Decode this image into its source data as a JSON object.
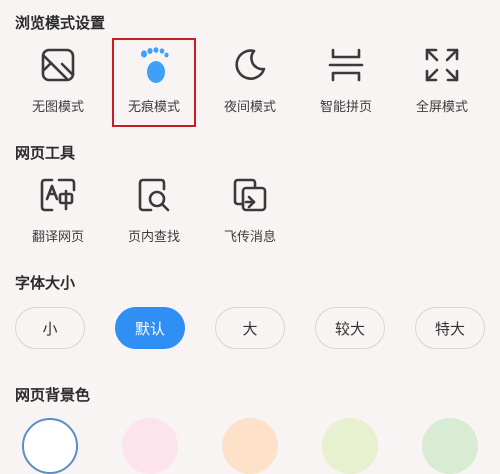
{
  "browse_mode": {
    "title": "浏览模式设置",
    "items": [
      {
        "label": "无图模式",
        "icon": "no-image-icon"
      },
      {
        "label": "无痕模式",
        "icon": "footprint-icon",
        "highlighted": true
      },
      {
        "label": "夜间模式",
        "icon": "moon-icon"
      },
      {
        "label": "智能拼页",
        "icon": "smart-page-icon"
      },
      {
        "label": "全屏模式",
        "icon": "fullscreen-icon"
      }
    ]
  },
  "web_tools": {
    "title": "网页工具",
    "items": [
      {
        "label": "翻译网页",
        "icon": "translate-icon"
      },
      {
        "label": "页内查找",
        "icon": "find-in-page-icon"
      },
      {
        "label": "飞传消息",
        "icon": "send-message-icon"
      }
    ]
  },
  "font_size": {
    "title": "字体大小",
    "options": [
      "小",
      "默认",
      "大",
      "较大",
      "特大"
    ],
    "selected": "默认"
  },
  "bg_color": {
    "title": "网页背景色",
    "swatches": [
      "#ffffff",
      "#fde3ec",
      "#fde1c9",
      "#e7f0cf",
      "#d7ecd3"
    ],
    "selected_index": 0
  },
  "colors": {
    "accent": "#2f8ff5",
    "highlight_border": "#c81d25"
  }
}
